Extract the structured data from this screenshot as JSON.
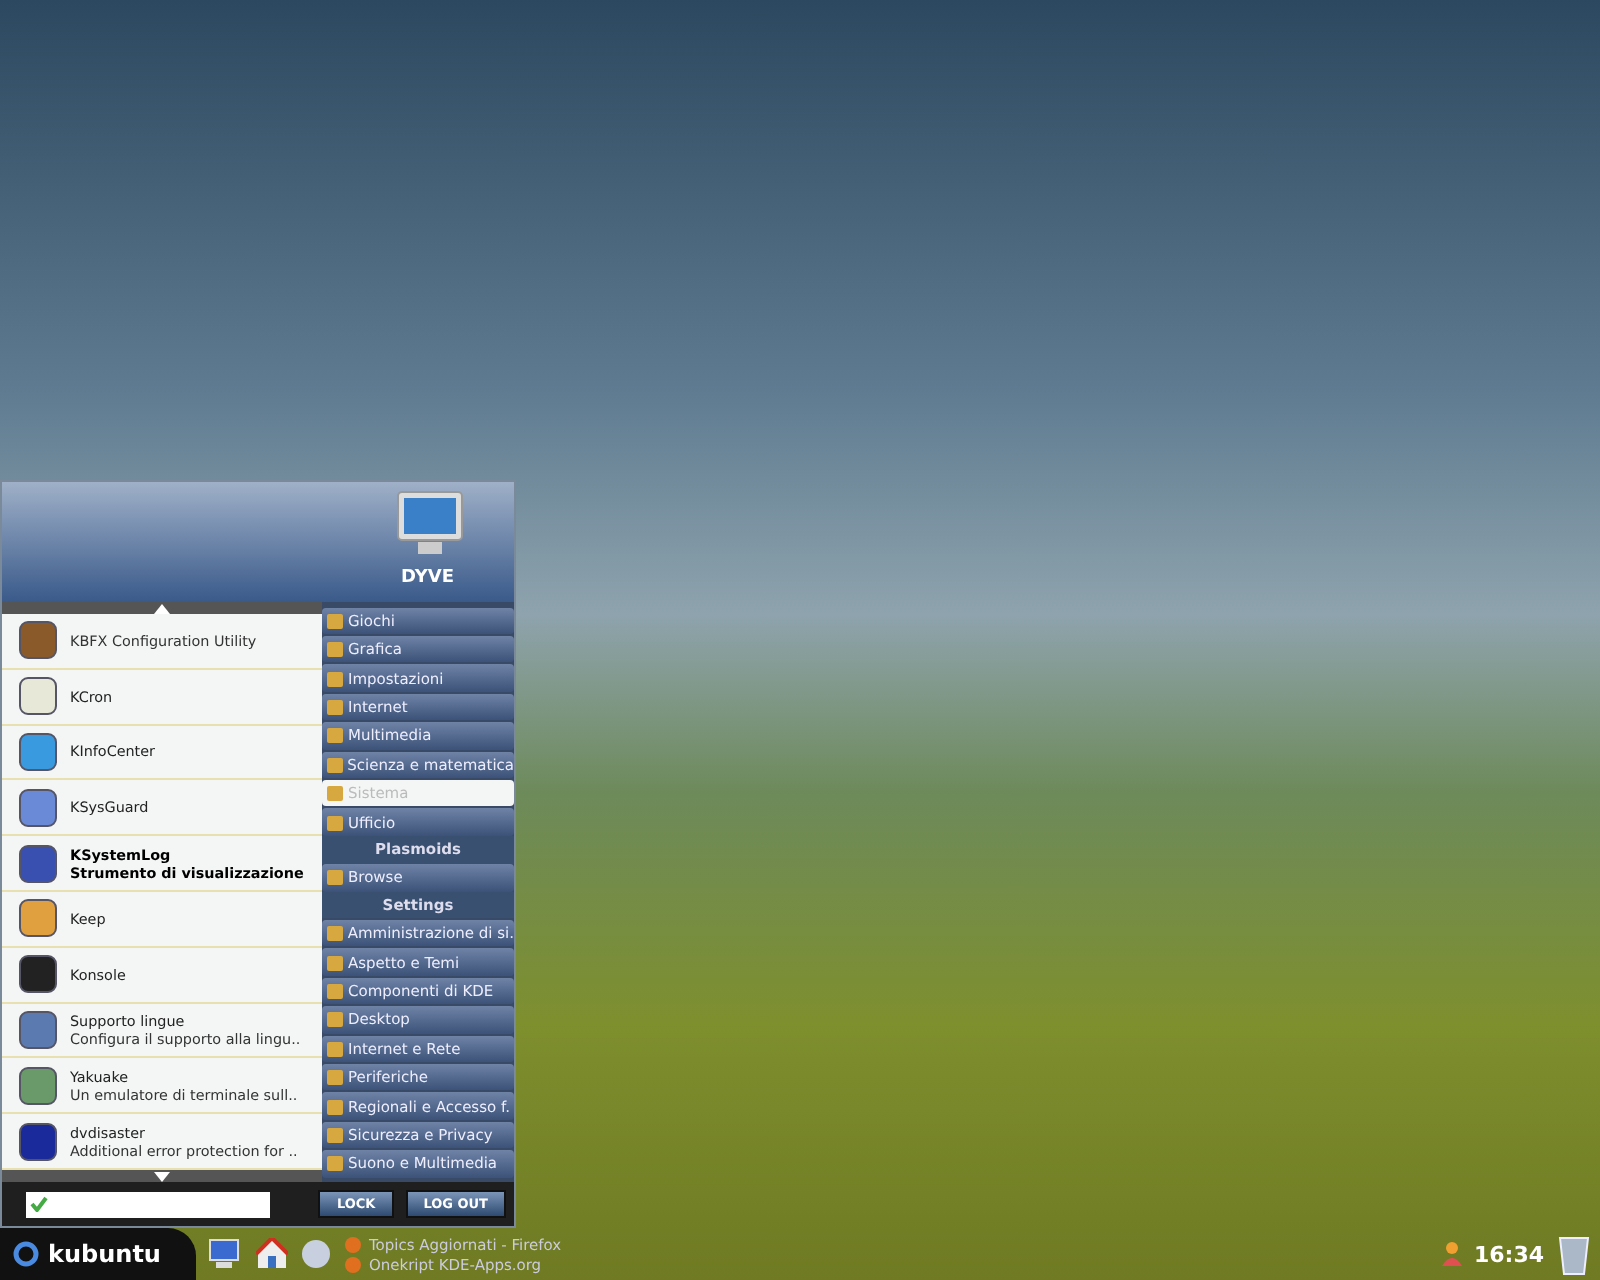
{
  "menu": {
    "user": "DYVE",
    "apps": [
      {
        "description": "KBFX Configuration Utility",
        "selected": false
      },
      {
        "name": "KCron",
        "selected": false
      },
      {
        "name": "KInfoCenter",
        "selected": false
      },
      {
        "name": "KSysGuard",
        "selected": false
      },
      {
        "name": "KSystemLog",
        "description": "Strumento di visualizzazione",
        "selected": true
      },
      {
        "name": "Keep",
        "selected": false
      },
      {
        "name": "Konsole",
        "selected": false
      },
      {
        "name": "Supporto lingue",
        "description": "Configura il supporto alla lingu..",
        "selected": false
      },
      {
        "name": "Yakuake",
        "description": "Un emulatore di terminale sull..",
        "selected": false
      },
      {
        "name": "dvdisaster",
        "description": "Additional error protection for ..",
        "selected": false
      }
    ],
    "categories": [
      {
        "kind": "item",
        "label": "Giochi",
        "selected": false
      },
      {
        "kind": "item",
        "label": "Grafica",
        "selected": false
      },
      {
        "kind": "item",
        "label": "Impostazioni",
        "selected": false
      },
      {
        "kind": "item",
        "label": "Internet",
        "selected": false
      },
      {
        "kind": "item",
        "label": "Multimedia",
        "selected": false
      },
      {
        "kind": "item",
        "label": "Scienza e matematica",
        "selected": false
      },
      {
        "kind": "item",
        "label": "Sistema",
        "selected": true
      },
      {
        "kind": "item",
        "label": "Ufficio",
        "selected": false
      },
      {
        "kind": "header",
        "label": "Plasmoids"
      },
      {
        "kind": "item",
        "label": "Browse",
        "selected": false
      },
      {
        "kind": "header",
        "label": "Settings"
      },
      {
        "kind": "item",
        "label": "Amministrazione di si.",
        "selected": false
      },
      {
        "kind": "item",
        "label": "Aspetto e Temi",
        "selected": false
      },
      {
        "kind": "item",
        "label": "Componenti di KDE",
        "selected": false
      },
      {
        "kind": "item",
        "label": "Desktop",
        "selected": false
      },
      {
        "kind": "item",
        "label": "Internet e Rete",
        "selected": false
      },
      {
        "kind": "item",
        "label": "Periferiche",
        "selected": false
      },
      {
        "kind": "item",
        "label": "Regionali e Accesso f.",
        "selected": false
      },
      {
        "kind": "item",
        "label": "Sicurezza e Privacy",
        "selected": false
      },
      {
        "kind": "item",
        "label": "Suono e Multimedia",
        "selected": false
      }
    ],
    "buttons": [
      "LOCK",
      "LOG OUT"
    ]
  },
  "taskbar": {
    "start": "kubuntu",
    "tasks": [
      "Topics Aggiornati - Firefox",
      "Onekript KDE-Apps.org"
    ],
    "clock": "16:34"
  }
}
